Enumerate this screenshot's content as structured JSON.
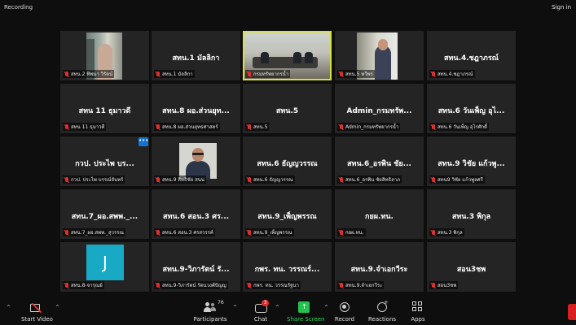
{
  "topbar": {
    "recording_label": "Recording",
    "signin_label": "Sign in"
  },
  "tiles": [
    {
      "name": "",
      "label": "สทน.2 ทิพนา วิรัตน์",
      "video": "v1"
    },
    {
      "name": "สทน.1 มัลลิกา",
      "label": "สทน.1 มัลลิกา"
    },
    {
      "name": "",
      "label": "กรมทรัพยากรน้ำ",
      "video": "v3",
      "active": true
    },
    {
      "name": "",
      "label": "สทน.5 ทวีพร",
      "video": "v4"
    },
    {
      "name": "สทน.4.ชฎาภรณ์",
      "label": "สทน.4.ชฎาภรณ์"
    },
    {
      "name": "สทน 11 ธุมาวดี",
      "label": "สทน 11 ธุมาวดี"
    },
    {
      "name": "สทน.8 ผอ.ส่วนยุท...",
      "label": "สทน.8 ผอ.ส่วนยุทธศาสตร์"
    },
    {
      "name": "สทน.5",
      "label": "สทน.5"
    },
    {
      "name": "Admin_กรมทรัพ...",
      "label": "Admin_กรมทรัพยากรน้ำ"
    },
    {
      "name": "สทน.6 วันเพ็ญ อุไ...",
      "label": "สทน.6 วันเพ็ญ อุไรศักดิ์"
    },
    {
      "name": "กวป. ประไพ  บร...",
      "label": "กวป. ประไพ  บรรณ์จันทร์",
      "more": true
    },
    {
      "name": "",
      "label": "สทน.9 สิทธิชัย สนน",
      "video": "v9"
    },
    {
      "name": "สทน.6 ธัญญวรรณ",
      "label": "สทน.6 ธัญญวรรณ"
    },
    {
      "name": "สทน.6_อรพิน ชัย...",
      "label": "สทน.6_อรพิน ชัยสิทธิลาภ"
    },
    {
      "name": "สทน.9 วิชัย แก้วพู...",
      "label": "สทน9 วิชัย แก้วพูลศรี"
    },
    {
      "name": "สทน.7_ผอ.สพพ._...",
      "label": "สทน.7_ผอ.สพพ._สุวรรณ"
    },
    {
      "name": "สทน.6 สอน.3 ศร...",
      "label": "สทน.6 สอน.3 ศรสวรรค์"
    },
    {
      "name": "สทน.9_เพ็ญพรรณ",
      "label": "สทน.9_เพ็ญพรรณ"
    },
    {
      "name": "กยผ.ทน.",
      "label": "กยผ.ทน."
    },
    {
      "name": "สทน.3 พิกุล",
      "label": "สทน.3 พิกุล"
    },
    {
      "name": "",
      "label": "สทน.8-จารุณย์",
      "avatar": "J"
    },
    {
      "name": "สทน.9-วิภารัตน์ รั...",
      "label": "สทน.9-วิภารัตน์ รัตนวงศ์ปัญญ"
    },
    {
      "name": "กพร. ทน. วรรณร์...",
      "label": "กพร. ทน. วรรณรัฐนา"
    },
    {
      "name": "สทน.9.จำเอกวีระ",
      "label": "สทน.9.จำเอกวีระ"
    },
    {
      "name": "สอน3ชพ",
      "label": "สอน3ชพ"
    }
  ],
  "toolbar": {
    "start_video": "Start Video",
    "participants": "Participants",
    "participants_count": "76",
    "chat": "Chat",
    "chat_badge": "3",
    "share_screen": "Share Screen",
    "record": "Record",
    "reactions": "Reactions",
    "apps": "Apps"
  }
}
